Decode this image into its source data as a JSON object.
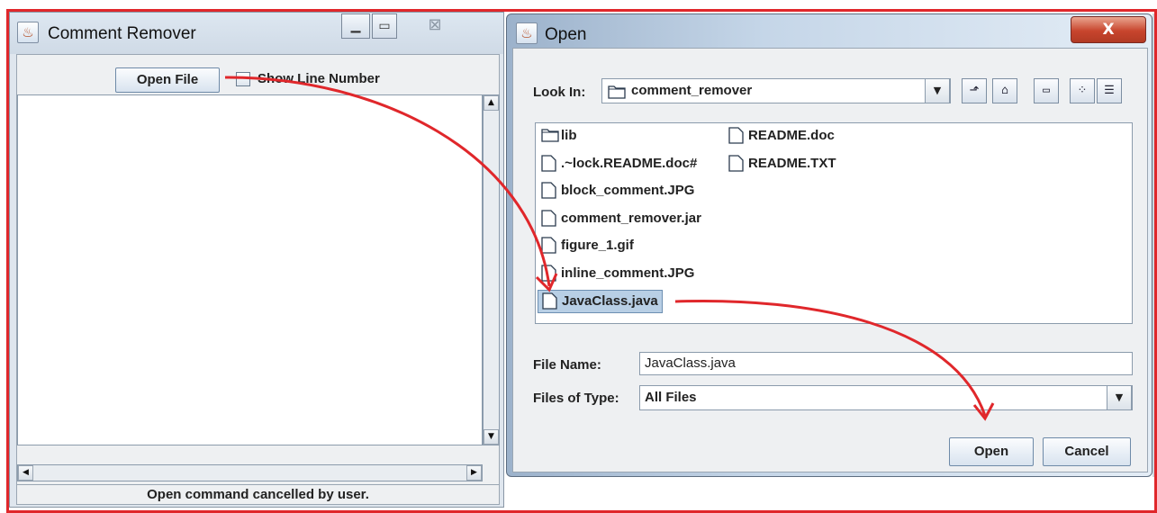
{
  "comment_remover": {
    "title": "Comment Remover",
    "app_icon": "java-cup-icon",
    "minimize": "minimize-icon",
    "maximize": "maximize-icon",
    "close": "close-icon",
    "open_file_label": "Open File",
    "show_line_number_label": "Show Line Number",
    "show_line_number_checked": false,
    "status": "Open command cancelled by user."
  },
  "open_dialog": {
    "title": "Open",
    "close_label": "X",
    "look_in_label": "Look In:",
    "look_in_value": "comment_remover",
    "toolbar_icons": [
      "up-one-level-icon",
      "home-icon",
      "new-folder-icon",
      "list-view-icon",
      "details-view-icon"
    ],
    "files": [
      {
        "name": "lib",
        "type": "folder"
      },
      {
        "name": ".~lock.README.doc#",
        "type": "file"
      },
      {
        "name": "block_comment.JPG",
        "type": "file"
      },
      {
        "name": "comment_remover.jar",
        "type": "file"
      },
      {
        "name": "figure_1.gif",
        "type": "file"
      },
      {
        "name": "inline_comment.JPG",
        "type": "file"
      },
      {
        "name": "JavaClass.java",
        "type": "file",
        "selected": true
      },
      {
        "name": "README.doc",
        "type": "file"
      },
      {
        "name": "README.TXT",
        "type": "file"
      }
    ],
    "file_name_label": "File Name:",
    "file_name_value": "JavaClass.java",
    "files_of_type_label": "Files of Type:",
    "files_of_type_value": "All Files",
    "open_label": "Open",
    "cancel_label": "Cancel"
  },
  "annotation": {
    "color": "#e0272b"
  }
}
